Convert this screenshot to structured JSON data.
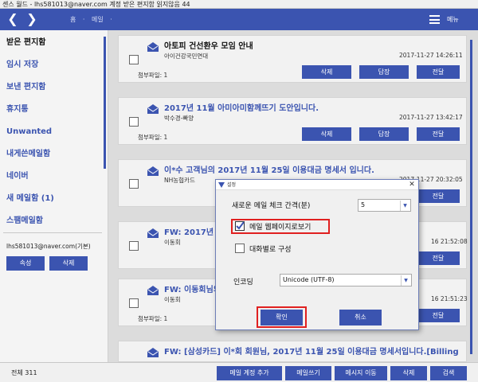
{
  "window": {
    "title": "센스 월드 - lhs581013@naver.com 계정  받은 편지함 읽지않음 44"
  },
  "topbar": {
    "breadcrumb": [
      "홈",
      "메일",
      ""
    ],
    "menu_label": "메뉴"
  },
  "sidebar": {
    "folders": [
      {
        "label": "받은 편지함",
        "selected": true
      },
      {
        "label": "임시 저장"
      },
      {
        "label": "보낸 편지함"
      },
      {
        "label": "휴지통"
      },
      {
        "label": "Unwanted"
      },
      {
        "label": "내게쓴메일함"
      },
      {
        "label": "네이버"
      },
      {
        "label": "새 메일함 (1)"
      },
      {
        "label": "스팸메일함"
      }
    ],
    "account": "lhs581013@naver.com(기본)",
    "props_label": "속성",
    "delete_label": "삭제"
  },
  "messages": [
    {
      "subject": "아토피 건선환우 모임 안내",
      "sender": "아이건강국민연대",
      "date": "2017-11-27 14:26:11",
      "attachments": "첨부파일: 1"
    },
    {
      "subject": "2017년 11월 아미아미함께뜨기 도안입니다.",
      "sender": "박수경-빠양",
      "date": "2017-11-27 13:42:17",
      "attachments": "첨부파일: 1"
    },
    {
      "subject": "이*수 고객님의 2017년 11월 25일 이용대금 명세서 입니다.",
      "sender": "NH농협카드",
      "date": "2017-11-27 20:32:05",
      "attachments": ""
    },
    {
      "subject": "FW: 2017년 1",
      "sender": "이동회",
      "date": "16 21:52:08",
      "attachments": ""
    },
    {
      "subject": "FW: 이동회님의",
      "sender": "이동회",
      "date": "16 21:51:23",
      "attachments": "첨부파일: 1"
    },
    {
      "subject": "FW: [삼성카드] 이*회 회원님, 2017년 11월 25일 이용대금 명세서입니다.[Billing",
      "sender": "",
      "date": "",
      "attachments": ""
    }
  ],
  "message_actions": {
    "delete": "삭제",
    "reply": "답장",
    "forward": "전달"
  },
  "bottombar": {
    "total": "전체 311",
    "add_account": "메일 계정 추가",
    "compose": "메일쓰기",
    "move": "메시지 이동",
    "delete": "삭제",
    "search": "검색"
  },
  "dialog": {
    "title": "설정",
    "interval_label": "새로운 메일 체크 간격(분)",
    "interval_value": "5",
    "webpage_label": "메일 웹페이지로보기",
    "webpage_checked": true,
    "conversation_label": "대화별로 구성",
    "conversation_checked": false,
    "encoding_label": "인코딩",
    "encoding_value": "Unicode (UTF-8)",
    "ok_label": "확인",
    "cancel_label": "취소"
  },
  "colors": {
    "accent": "#3b54b0",
    "highlight": "#e02020",
    "card_bg": "#f2f2f2"
  },
  "icons": {
    "back": "chevron-left-icon",
    "forward": "chevron-right-icon",
    "menu": "hamburger-icon",
    "envelope": "envelope-icon",
    "dropdown": "dropdown-arrow-icon",
    "check": "check-icon",
    "close": "close-icon"
  }
}
